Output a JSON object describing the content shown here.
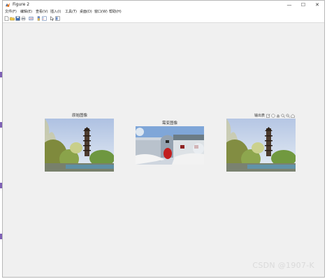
{
  "window": {
    "title": "Figure 2",
    "minimize": "—",
    "maximize": "☐",
    "close": "✕"
  },
  "menu": {
    "items": [
      "文件(F)",
      "编辑(E)",
      "查看(V)",
      "插入(I)",
      "工具(T)",
      "桌面(D)",
      "窗口(W)",
      "帮助(H)"
    ]
  },
  "toolbar": {
    "icons": [
      "new-figure-icon",
      "open-icon",
      "save-icon",
      "print-icon",
      "link-icon",
      "insert-colorbar-icon",
      "insert-legend-icon",
      "select-arrow-icon",
      "property-editor-icon"
    ]
  },
  "axes": [
    {
      "title": "原始图像"
    },
    {
      "title": "需变图像"
    },
    {
      "title": "输出表"
    }
  ],
  "axes_toolbar": {
    "icons": [
      "export-icon",
      "brush-icon",
      "pan-icon",
      "zoom-in-icon",
      "zoom-out-icon",
      "home-icon"
    ]
  },
  "watermark": "CSDN @1907-K",
  "colors": {
    "frame": "#f0f0f0",
    "accent_sidebar": "#7e60b5"
  }
}
